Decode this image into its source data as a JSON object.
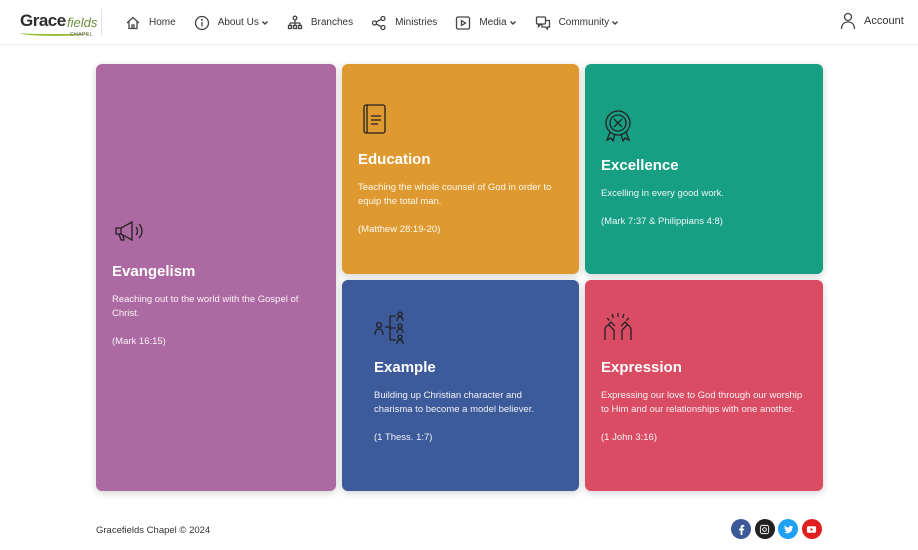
{
  "logo": {
    "brand": "Grace",
    "brand_tail": "fields",
    "sub": "CHAPEL"
  },
  "nav": {
    "home": "Home",
    "about": "About Us",
    "branches": "Branches",
    "ministries": "Ministries",
    "media": "Media",
    "community": "Community"
  },
  "account": {
    "label": "Account"
  },
  "cards": {
    "evangelism": {
      "title": "Evangelism",
      "text": "Reaching out to the world with the Gospel of Christ.",
      "ref": "(Mark 16:15)",
      "color": "#ad6aa2",
      "icon": "megaphone-icon"
    },
    "education": {
      "title": "Education",
      "text": "Teaching the whole counsel of God in order to equip the total man.",
      "ref": "(Matthew 28:19-20)",
      "color": "#de9a30",
      "icon": "book-icon"
    },
    "excellence": {
      "title": "Excellence",
      "text": "Excelling in every good work.",
      "ref": "(Mark 7:37 & Philippians 4:8)",
      "color": "#179f84",
      "icon": "award-badge-icon"
    },
    "example": {
      "title": "Example",
      "text": "Building up Christian character and charisma to become a model believer.",
      "ref": "(1 Thess. 1:7)",
      "color": "#3d5a9b",
      "icon": "mentorship-icon"
    },
    "expression": {
      "title": "Expression",
      "text": "Expressing our love to God through our worship to Him and our relationships with one another.",
      "ref": "(1 John 3:16)",
      "color": "#d94c64",
      "icon": "raised-hands-icon"
    }
  },
  "footer": {
    "copyright": "Gracefields Chapel © 2024"
  },
  "socials": [
    {
      "name": "facebook-icon",
      "color": "#3b5998"
    },
    {
      "name": "instagram-icon",
      "color": "#222222"
    },
    {
      "name": "twitter-icon",
      "color": "#1da1f2"
    },
    {
      "name": "youtube-icon",
      "color": "#e02020"
    }
  ]
}
